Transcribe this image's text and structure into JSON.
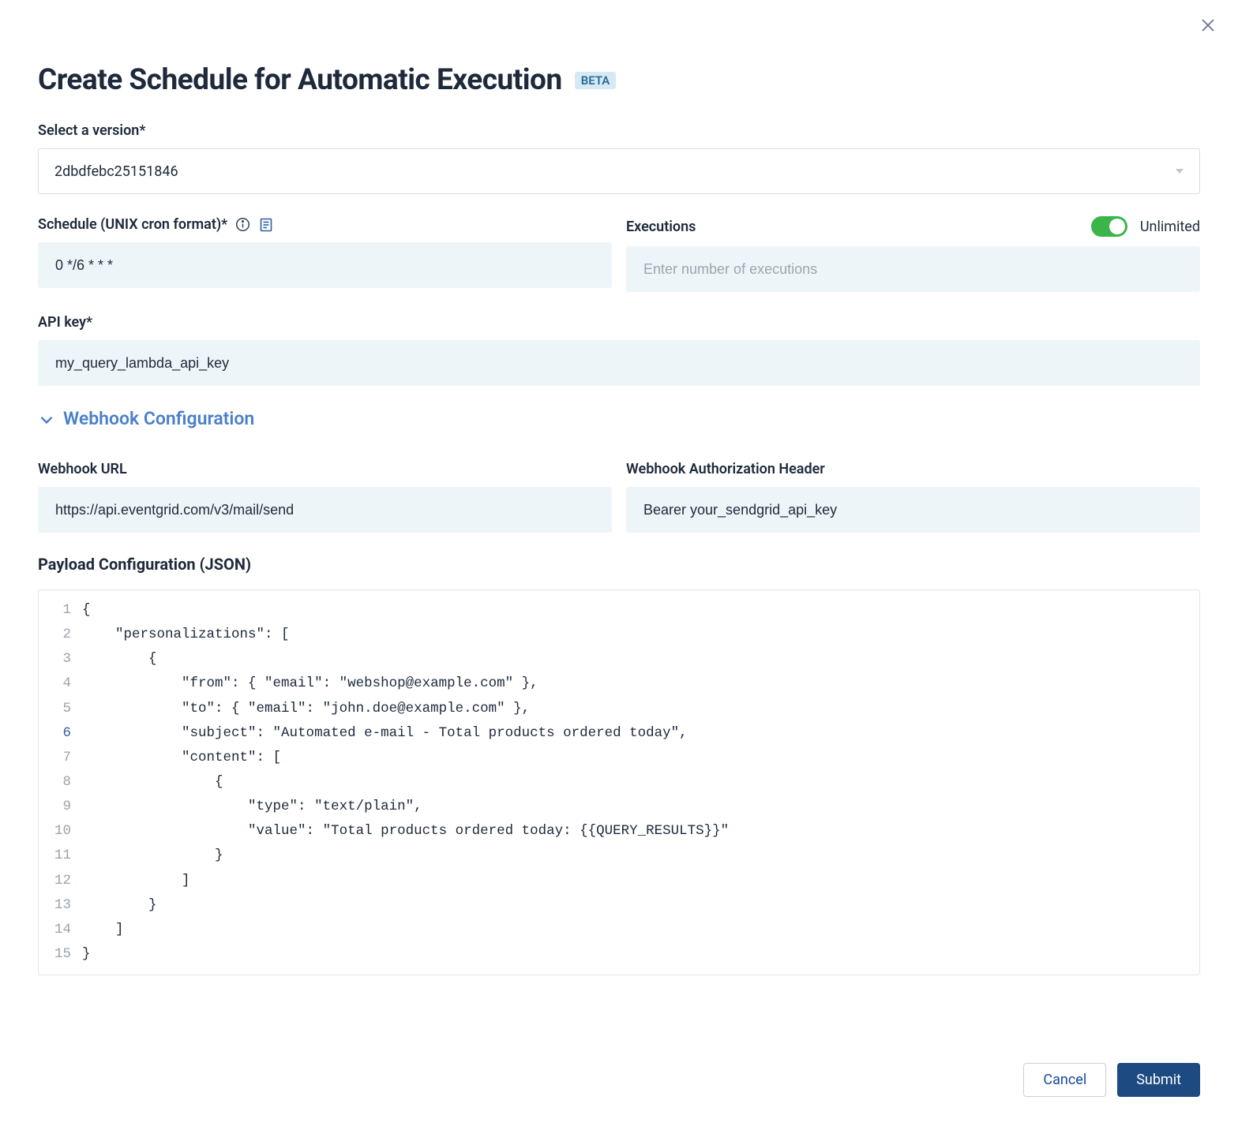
{
  "pageTitle": "Create Schedule for Automatic Execution",
  "betaLabel": "BETA",
  "version": {
    "label": "Select a version*",
    "value": "2dbdfebc25151846"
  },
  "schedule": {
    "label": "Schedule (UNIX cron format)*",
    "value": "0 */6 * * *"
  },
  "executions": {
    "label": "Executions",
    "toggleLabel": "Unlimited",
    "placeholder": "Enter number of executions",
    "value": ""
  },
  "apiKey": {
    "label": "API key*",
    "value": "my_query_lambda_api_key"
  },
  "webhookSection": "Webhook Configuration",
  "webhookUrl": {
    "label": "Webhook URL",
    "value": "https://api.eventgrid.com/v3/mail/send"
  },
  "webhookAuth": {
    "label": "Webhook Authorization Header",
    "value": "Bearer your_sendgrid_api_key"
  },
  "payload": {
    "label": "Payload Configuration (JSON)",
    "lines": [
      "{",
      "    \"personalizations\": [",
      "        {",
      "            \"from\": { \"email\": \"webshop@example.com\" },",
      "            \"to\": { \"email\": \"john.doe@example.com\" },",
      "            \"subject\": \"Automated e-mail - Total products ordered today\",",
      "            \"content\": [",
      "                {",
      "                    \"type\": \"text/plain\",",
      "                    \"value\": \"Total products ordered today: {{QUERY_RESULTS}}\"",
      "                }",
      "            ]",
      "        }",
      "    ]",
      "}"
    ],
    "highlightLine": 6
  },
  "buttons": {
    "cancel": "Cancel",
    "submit": "Submit"
  }
}
